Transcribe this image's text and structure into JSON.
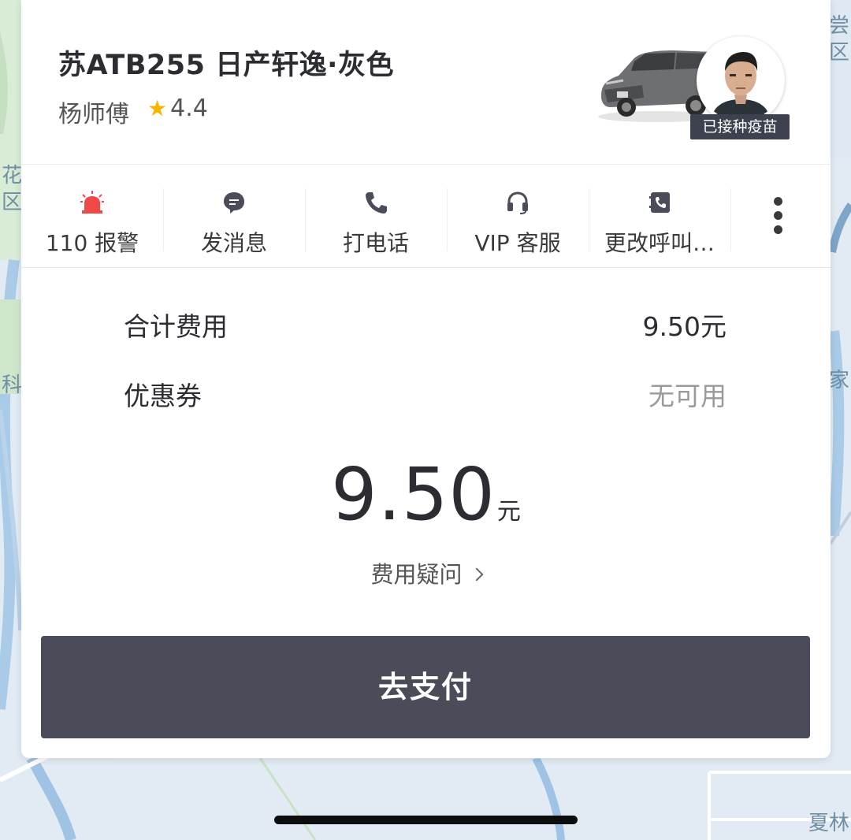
{
  "driver": {
    "vehicle_title": "苏ATB255  日产轩逸·灰色",
    "name": "杨师傅",
    "rating": "4.4",
    "badge": "已接种疫苗"
  },
  "actions": [
    {
      "label": "110 报警",
      "icon": "alarm-light-icon"
    },
    {
      "label": "发消息",
      "icon": "message-bubble-icon"
    },
    {
      "label": "打电话",
      "icon": "phone-icon"
    },
    {
      "label": "VIP 客服",
      "icon": "headset-icon"
    },
    {
      "label": "更改呼叫…",
      "icon": "contact-book-icon"
    }
  ],
  "fees": {
    "total_label": "合计费用",
    "total_value": "9.50元",
    "coupon_label": "优惠券",
    "coupon_value": "无可用"
  },
  "amount": {
    "value": "9.50",
    "unit": "元"
  },
  "fee_question": "费用疑问",
  "pay_button": "去支付",
  "map_labels": {
    "left": [
      "花",
      "区",
      "科"
    ],
    "right": [
      "尝",
      "区",
      "家",
      "夏林"
    ]
  },
  "colors": {
    "accent_dark": "#4a4c5a",
    "star": "#f7b500",
    "alarm_red": "#f14848",
    "muted_text": "#9a9a9a"
  }
}
